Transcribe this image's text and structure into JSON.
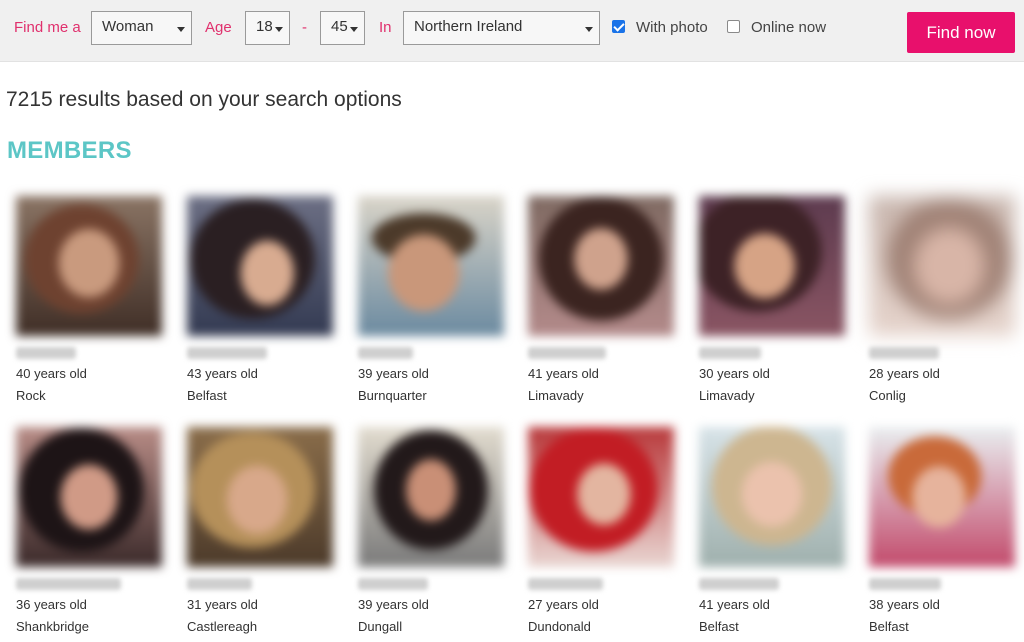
{
  "search": {
    "find_me_label": "Find me a",
    "gender_value": "Woman",
    "age_label": "Age",
    "age_min": "18",
    "age_separator": "-",
    "age_max": "45",
    "in_label": "In",
    "location_value": "Northern Ireland",
    "with_photo_label": "With photo",
    "with_photo_checked": true,
    "online_now_label": "Online now",
    "online_now_checked": false,
    "find_button_label": "Find now"
  },
  "results_text": "7215 results based on your search options",
  "section_title": "MEMBERS",
  "colors": {
    "accent_pink": "#e8106c",
    "label_pink": "#e0306d",
    "section_teal": "#5cc6c6"
  },
  "members": [
    {
      "age": "40 years old",
      "location": "Rock"
    },
    {
      "age": "43 years old",
      "location": "Belfast"
    },
    {
      "age": "39 years old",
      "location": "Burnquarter"
    },
    {
      "age": "41 years old",
      "location": "Limavady"
    },
    {
      "age": "30 years old",
      "location": "Limavady"
    },
    {
      "age": "28 years old",
      "location": "Conlig"
    },
    {
      "age": "36 years old",
      "location": "Shankbridge"
    },
    {
      "age": "31 years old",
      "location": "Castlereagh"
    },
    {
      "age": "39 years old",
      "location": "Dungall"
    },
    {
      "age": "27 years old",
      "location": "Dundonald"
    },
    {
      "age": "41 years old",
      "location": "Belfast"
    },
    {
      "age": "38 years old",
      "location": "Belfast"
    }
  ]
}
